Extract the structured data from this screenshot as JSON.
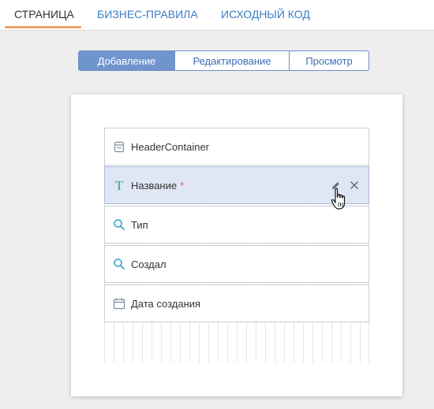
{
  "tabs": [
    {
      "label": "СТРАНИЦА",
      "active": true
    },
    {
      "label": "БИЗНЕС-ПРАВИЛА",
      "active": false
    },
    {
      "label": "ИСХОДНЫЙ КОД",
      "active": false
    }
  ],
  "mode_switch": {
    "options": [
      "Добавление",
      "Редактирование",
      "Просмотр"
    ],
    "selected": "Добавление"
  },
  "fields": [
    {
      "label": "HeaderContainer",
      "icon": "container-icon",
      "required": false,
      "selected": false
    },
    {
      "label": "Название",
      "icon": "text-icon",
      "required": true,
      "selected": true
    },
    {
      "label": "Тип",
      "icon": "lookup-icon",
      "required": false,
      "selected": false
    },
    {
      "label": "Создал",
      "icon": "lookup-icon",
      "required": false,
      "selected": false
    },
    {
      "label": "Дата создания",
      "icon": "calendar-icon",
      "required": false,
      "selected": false
    }
  ],
  "required_mark": "*",
  "colors": {
    "accent_blue": "#7094cd",
    "link_blue": "#3b7cc5",
    "tab_underline": "#f2a26b",
    "selected_field_bg": "#dfe6f5",
    "required_red": "#e0594a",
    "icon_teal": "#3aa4c9"
  }
}
